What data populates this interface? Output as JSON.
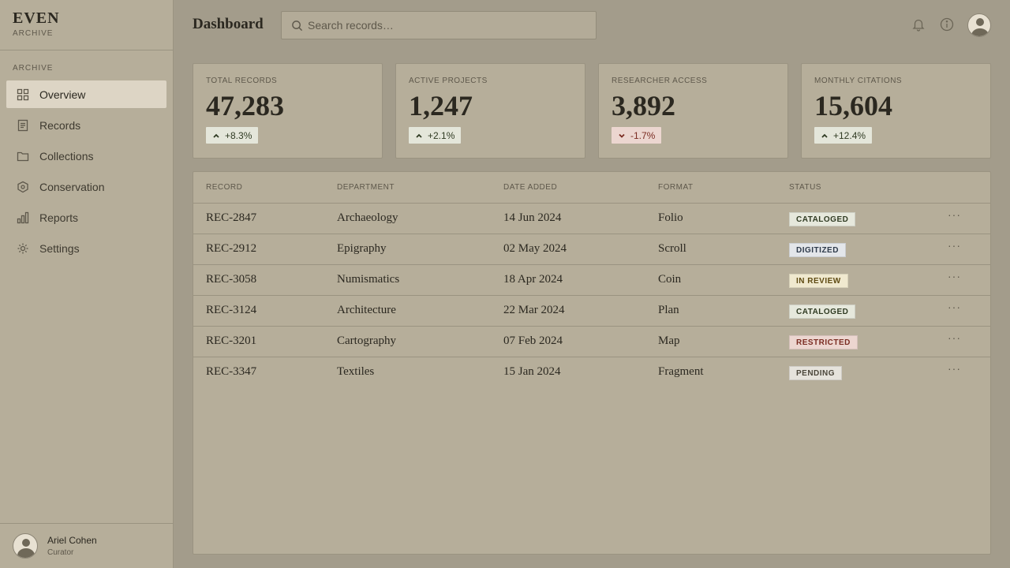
{
  "brand": {
    "name": "EVEN",
    "sub": "ARCHIVE"
  },
  "sidebar": {
    "section": "ARCHIVE",
    "items": [
      {
        "label": "Overview",
        "icon": "grid-icon",
        "active": true
      },
      {
        "label": "Records",
        "icon": "document-icon"
      },
      {
        "label": "Collections",
        "icon": "folder-icon"
      },
      {
        "label": "Conservation",
        "icon": "shield-icon"
      },
      {
        "label": "Reports",
        "icon": "bar-chart-icon"
      },
      {
        "label": "Settings",
        "icon": "gear-icon"
      }
    ],
    "user": {
      "name": "Ariel Cohen",
      "role": "Curator"
    }
  },
  "header": {
    "title": "Dashboard",
    "search_placeholder": "Search records…"
  },
  "stats": [
    {
      "label": "TOTAL RECORDS",
      "value": "47,283",
      "change": "+8.3%",
      "direction": "up"
    },
    {
      "label": "ACTIVE PROJECTS",
      "value": "1,247",
      "change": "+2.1%",
      "direction": "up"
    },
    {
      "label": "RESEARCHER ACCESS",
      "value": "3,892",
      "change": "-1.7%",
      "direction": "down"
    },
    {
      "label": "MONTHLY CITATIONS",
      "value": "15,604",
      "change": "+12.4%",
      "direction": "up"
    }
  ],
  "table": {
    "columns": [
      "RECORD",
      "DEPARTMENT",
      "DATE ADDED",
      "FORMAT",
      "STATUS"
    ],
    "rows": [
      {
        "record": "REC-2847",
        "department": "Archaeology",
        "date": "14 Jun 2024",
        "format": "Folio",
        "status": "CATALOGED"
      },
      {
        "record": "REC-2912",
        "department": "Epigraphy",
        "date": "02 May 2024",
        "format": "Scroll",
        "status": "DIGITIZED"
      },
      {
        "record": "REC-3058",
        "department": "Numismatics",
        "date": "18 Apr 2024",
        "format": "Coin",
        "status": "IN REVIEW"
      },
      {
        "record": "REC-3124",
        "department": "Architecture",
        "date": "22 Mar 2024",
        "format": "Plan",
        "status": "CATALOGED"
      },
      {
        "record": "REC-3201",
        "department": "Cartography",
        "date": "07 Feb 2024",
        "format": "Map",
        "status": "RESTRICTED"
      },
      {
        "record": "REC-3347",
        "department": "Textiles",
        "date": "15 Jan 2024",
        "format": "Fragment",
        "status": "PENDING"
      }
    ],
    "more_glyph": "···"
  }
}
